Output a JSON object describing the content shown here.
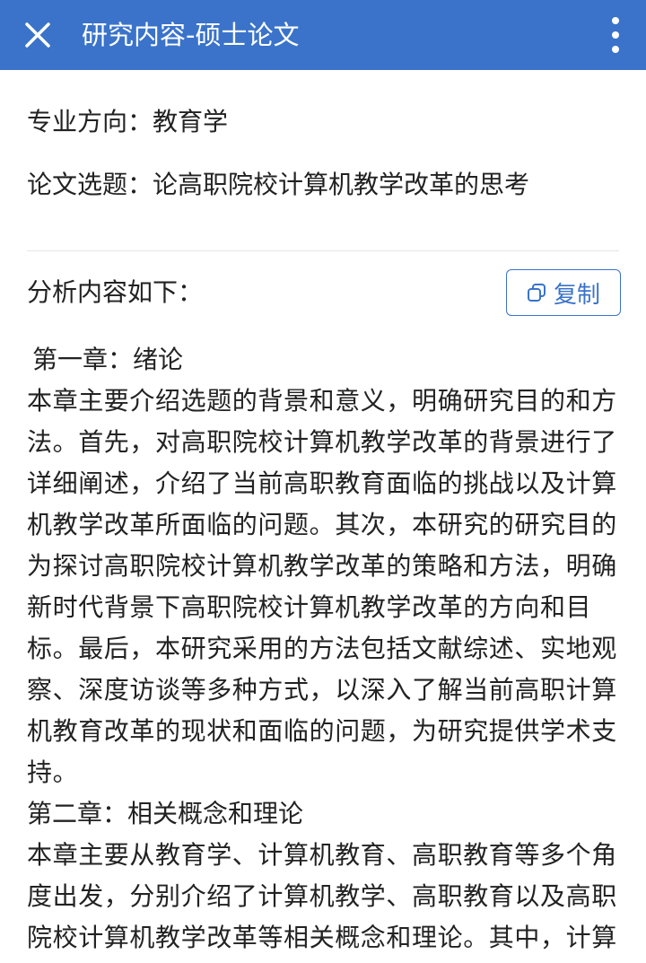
{
  "header": {
    "title": "研究内容-硕士论文",
    "accent_color": "#3a73c9",
    "icons": {
      "close": "close-icon",
      "more": "more-vertical-icon"
    }
  },
  "meta": {
    "major_line": "专业方向：教育学",
    "topic_line": "论文选题：论高职院校计算机教学改革的思考"
  },
  "analysis": {
    "label": "分析内容如下：",
    "copy_button_label": "复制",
    "copy_icon": "copy-icon"
  },
  "content": {
    "chapter1_heading": "第一章：绪论",
    "chapter1_text": "本章主要介绍选题的背景和意义，明确研究目的和方法。首先，对高职院校计算机教学改革的背景进行了详细阐述，介绍了当前高职教育面临的挑战以及计算机教学改革所面临的问题。其次，本研究的研究目的为探讨高职院校计算机教学改革的策略和方法，明确新时代背景下高职院校计算机教学改革的方向和目标。最后，本研究采用的方法包括文献综述、实地观察、深度访谈等多种方式，以深入了解当前高职计算机教育改革的现状和面临的问题，为研究提供学术支持。",
    "chapter2_heading": "第二章：相关概念和理论",
    "chapter2_text": "本章主要从教育学、计算机教育、高职教育等多个角度出发，分别介绍了计算机教学、高职教育以及高职院校计算机教学改革等相关概念和理论。其中，计算机教学涉及教"
  }
}
